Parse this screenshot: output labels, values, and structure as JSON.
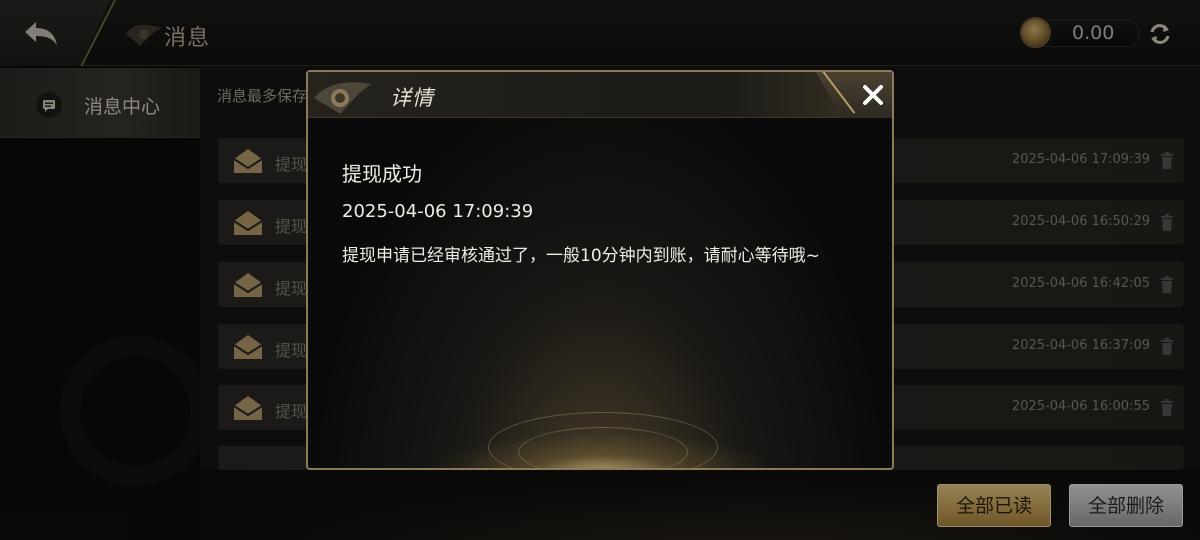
{
  "header": {
    "title": "消息",
    "balance": "0.00",
    "icons": {
      "back": "back-arrow-icon",
      "coin": "coin-icon",
      "refresh": "refresh-icon"
    }
  },
  "sidebar": {
    "items": [
      {
        "label": "消息中心",
        "icon": "message-icon",
        "active": true
      }
    ]
  },
  "main": {
    "notice": "消息最多保存",
    "messages": [
      {
        "title": "提现",
        "time": "2025-04-06 17:09:39"
      },
      {
        "title": "提现",
        "time": "2025-04-06 16:50:29"
      },
      {
        "title": "提现",
        "time": "2025-04-06 16:42:05"
      },
      {
        "title": "提现",
        "time": "2025-04-06 16:37:09"
      },
      {
        "title": "提现",
        "time": "2025-04-06 16:00:55"
      }
    ],
    "buttons": {
      "mark_all_read": "全部已读",
      "delete_all": "全部删除"
    }
  },
  "dialog": {
    "title": "详情",
    "detail_title": "提现成功",
    "detail_time": "2025-04-06 17:09:39",
    "detail_body": "提现申请已经审核通过了，一般10分钟内到账，请耐心等待哦~"
  },
  "colors": {
    "gold": "#c9a45a",
    "gold_border": "#8b7a57",
    "background": "#0b0b0b"
  }
}
